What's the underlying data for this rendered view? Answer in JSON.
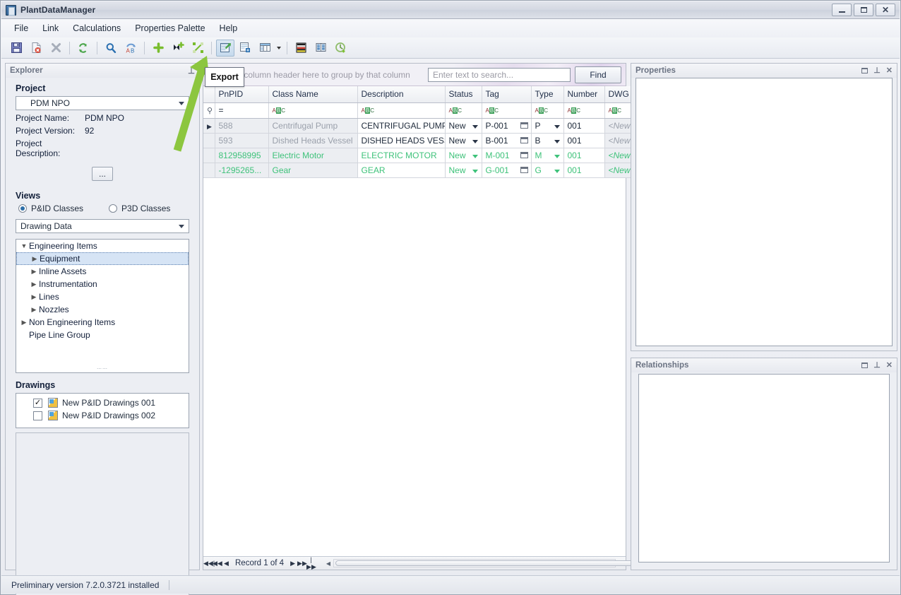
{
  "window": {
    "title": "PlantDataManager",
    "icon": "app-icon",
    "minimize_label": "Minimize",
    "maximize_label": "Maximize",
    "close_label": "Close"
  },
  "menubar": {
    "items": [
      {
        "label": "File"
      },
      {
        "label": "Link"
      },
      {
        "label": "Calculations"
      },
      {
        "label": "Properties Palette"
      },
      {
        "label": "Help"
      }
    ]
  },
  "toolbar": {
    "buttons": [
      {
        "name": "save-icon",
        "title": "Save"
      },
      {
        "name": "delete-document-icon",
        "title": "Delete document"
      },
      {
        "name": "close-x-icon",
        "title": "Close"
      },
      {
        "name": "refresh-icon",
        "title": "Refresh"
      },
      {
        "name": "search-icon",
        "title": "Search"
      },
      {
        "name": "rename-ab-icon",
        "title": "Rename"
      },
      {
        "name": "add-plus-icon",
        "title": "Add"
      },
      {
        "name": "add-item-icon",
        "title": "Add item"
      },
      {
        "name": "unlink-icon",
        "title": "Unlink"
      },
      {
        "name": "export-icon",
        "title": "Export"
      },
      {
        "name": "import-icon",
        "title": "Import"
      },
      {
        "name": "table-layout-icon",
        "title": "Table layout"
      },
      {
        "name": "color-legend-icon",
        "title": "Color legend"
      },
      {
        "name": "columns-icon",
        "title": "Columns"
      },
      {
        "name": "history-icon",
        "title": "History"
      }
    ],
    "tooltip": "Export",
    "pressed_button": "export-icon"
  },
  "explorer": {
    "caption": "Explorer",
    "pin_icon": "pin-icon",
    "project_section_title": "Project",
    "project_combo_value": "PDM NPO",
    "fields": [
      {
        "label": "Project Name:",
        "value": "PDM NPO"
      },
      {
        "label": "Project Version:",
        "value": "92"
      },
      {
        "label": "Project Description:",
        "value": ""
      }
    ],
    "ellipsis_button": "...",
    "views_section_title": "Views",
    "view_options": [
      {
        "label": "P&ID Classes",
        "selected": true
      },
      {
        "label": "P3D Classes",
        "selected": false
      }
    ],
    "data_combo_value": "Drawing Data",
    "tree": [
      {
        "label": "Engineering Items",
        "level": 0,
        "expanded": true,
        "selected": false
      },
      {
        "label": "Equipment",
        "level": 1,
        "expanded": false,
        "selected": true
      },
      {
        "label": "Inline Assets",
        "level": 1,
        "expanded": false,
        "selected": false
      },
      {
        "label": "Instrumentation",
        "level": 1,
        "expanded": false,
        "selected": false
      },
      {
        "label": "Lines",
        "level": 1,
        "expanded": false,
        "selected": false
      },
      {
        "label": "Nozzles",
        "level": 1,
        "expanded": false,
        "selected": false
      },
      {
        "label": "Non Engineering Items",
        "level": 0,
        "expanded": false,
        "selected": false
      },
      {
        "label": "Pipe Line Group",
        "level": 0,
        "expanded": null,
        "selected": false
      }
    ],
    "drawings_section_title": "Drawings",
    "drawings": [
      {
        "label": "New P&ID Drawings 001",
        "checked": true
      },
      {
        "label": "New P&ID Drawings 002",
        "checked": false
      }
    ]
  },
  "grid": {
    "group_hint": "Drag a column header here to group by that column",
    "search_placeholder": "Enter text to search...",
    "search_value": "",
    "find_label": "Find",
    "columns": [
      "PnPID",
      "Class Name",
      "Description",
      "Status",
      "Tag",
      "Type",
      "Number",
      "DWG Number"
    ],
    "filter_row": {
      "pnpid": "=",
      "others": "ABC"
    },
    "rows": [
      {
        "selected": true,
        "new": false,
        "pnpid": "588",
        "class_name": "Centrifugal Pump",
        "description": "CENTRIFUGAL PUMP",
        "status": "New",
        "tag": "P-001",
        "type": "P",
        "number": "001",
        "dwg_number": "<New P&ID D"
      },
      {
        "selected": false,
        "new": false,
        "pnpid": "593",
        "class_name": "Dished Heads Vessel",
        "description": "DISHED HEADS VESSEL",
        "status": "New",
        "tag": "B-001",
        "type": "B",
        "number": "001",
        "dwg_number": "<New P&ID D"
      },
      {
        "selected": false,
        "new": true,
        "pnpid": "812958995",
        "class_name": "Electric Motor",
        "description": "ELECTRIC MOTOR",
        "status": "New",
        "tag": "M-001",
        "type": "M",
        "number": "001",
        "dwg_number": "<New P&ID D"
      },
      {
        "selected": false,
        "new": true,
        "pnpid": "-1295265...",
        "class_name": "Gear",
        "description": "GEAR",
        "status": "New",
        "tag": "G-001",
        "type": "G",
        "number": "001",
        "dwg_number": "<New P&ID D"
      }
    ],
    "footer": {
      "record_text": "Record 1 of 4",
      "first_label": "First record",
      "prev_page_label": "Previous page",
      "prev_label": "Previous record",
      "next_label": "Next record",
      "next_page_label": "Next page",
      "last_label": "Last record"
    }
  },
  "properties_panel": {
    "caption": "Properties",
    "restore_icon": "restore-icon",
    "pin_icon": "pin-icon",
    "close_icon": "close-icon"
  },
  "relationships_panel": {
    "caption": "Relationships",
    "restore_icon": "restore-icon",
    "pin_icon": "pin-icon",
    "close_icon": "close-icon"
  },
  "statusbar": {
    "text": "Preliminary version 7.2.0.3721 installed"
  },
  "colors": {
    "accent_arrow": "#8cc63f",
    "new_row_text": "#3ec27a",
    "title_bar": "#d4d8e2",
    "panel_bg": "#eceef3",
    "selection": "#d6e4f5"
  }
}
